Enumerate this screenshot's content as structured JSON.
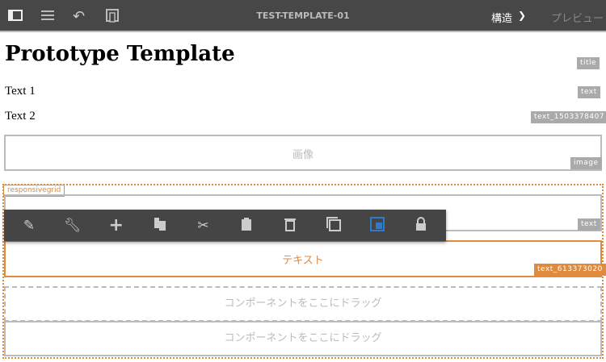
{
  "topbar": {
    "title": "TEST-TEMPLATE-01",
    "mode": "構造",
    "preview": "プレビュー"
  },
  "page": {
    "title": "Prototype Template",
    "text1": "Text 1",
    "text2": "Text 2",
    "image_placeholder": "画像",
    "text_placeholder": "テキスト",
    "drop_placeholder": "コンポーネントをここにドラッグ"
  },
  "tags": {
    "title": "title",
    "text": "text",
    "text2": "text_1503378407",
    "image": "image",
    "grid": "responsivegrid",
    "text_inner": "text",
    "text_selected": "text_613373020"
  },
  "toolbar": [
    "edit",
    "configure",
    "insert",
    "copy",
    "cut",
    "paste",
    "delete",
    "group",
    "parent",
    "lock"
  ],
  "colors": {
    "accent": "#e08a3c",
    "topbar": "#474747",
    "active": "#2f7ac9"
  }
}
